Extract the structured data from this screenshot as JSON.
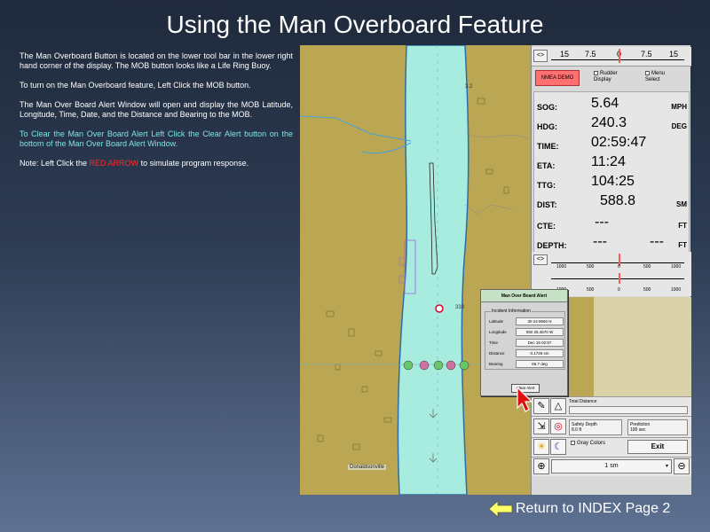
{
  "title": "Using the Man Overboard Feature",
  "instructions": {
    "p1": "The Man Overboard Button is located on the lower tool bar in the lower right hand corner of the display.  The MOB button looks like a Life Ring Buoy.",
    "p2": "To turn on the Man Overboard feature, Left Click the MOB button.",
    "p3": "The Man Over Board Alert Window will open and display the MOB Latitude, Longitude, Time, Date, and the Distance and Bearing to the MOB.",
    "p4": "To Clear the Man Over Board  Alert Left Click the Clear Alert button on the bottom of the Man Over Board Alert Window.",
    "p5_prefix": "Note:  Left Click the ",
    "p5_highlight": "RED ARROW",
    "p5_suffix": " to simulate program response."
  },
  "chart": {
    "place_label": "Donaldsonville",
    "depth_1": "3.2",
    "depth_2": "333"
  },
  "top_scale": {
    "arrow": "<>",
    "ticks": [
      "15",
      "7.5",
      "0",
      "7.5",
      "15"
    ]
  },
  "controls": {
    "nmea_demo": "NMEA DEMO",
    "rudder_display": "Rudder Display",
    "menu_select": "Menu Select"
  },
  "nav": {
    "sog": {
      "label": "SOG:",
      "value": "5.64",
      "unit": "MPH"
    },
    "hdg": {
      "label": "HDG:",
      "value": "240.3",
      "unit": "DEG"
    },
    "time": {
      "label": "TIME:",
      "value": "02:59:47"
    },
    "eta": {
      "label": "ETA:",
      "value": "11:24"
    },
    "ttg": {
      "label": "TTG:",
      "value": "104:25"
    },
    "dist": {
      "label": "DIST:",
      "value": "588.8",
      "unit": "SM"
    },
    "cte": {
      "label": "CTE:",
      "value": "---",
      "unit": "FT"
    },
    "depth": {
      "label": "DEPTH:",
      "value_left": "---",
      "value_right": "---",
      "unit": "FT"
    }
  },
  "bottom_scale": {
    "arrow": "<>",
    "ticks": [
      "1000",
      "500",
      "0",
      "500",
      "1000"
    ]
  },
  "tools": {
    "total_distance": "Total Distance",
    "safety_depth_label": "Safety Depth",
    "safety_depth_value": "8.0 ft",
    "prediction_label": "Prediction",
    "prediction_value": "100 sec",
    "gray_colors": "Gray Colors",
    "exit": "Exit",
    "zoom": "1 sm"
  },
  "mob": {
    "title": "Man Over Board Alert",
    "group": "Incident Information",
    "rows": [
      {
        "k": "Latitude",
        "v": "30 24.9650 N"
      },
      {
        "k": "Longitude",
        "v": "092 25.4670 W"
      },
      {
        "k": "Time",
        "v": "Dec 15 02:57"
      },
      {
        "k": "Distance",
        "v": "0.1726 sm"
      },
      {
        "k": "Bearing",
        "v": "65.7 deg"
      }
    ],
    "clear": "Clear Alert"
  },
  "return_link": "Return to INDEX Page 2"
}
